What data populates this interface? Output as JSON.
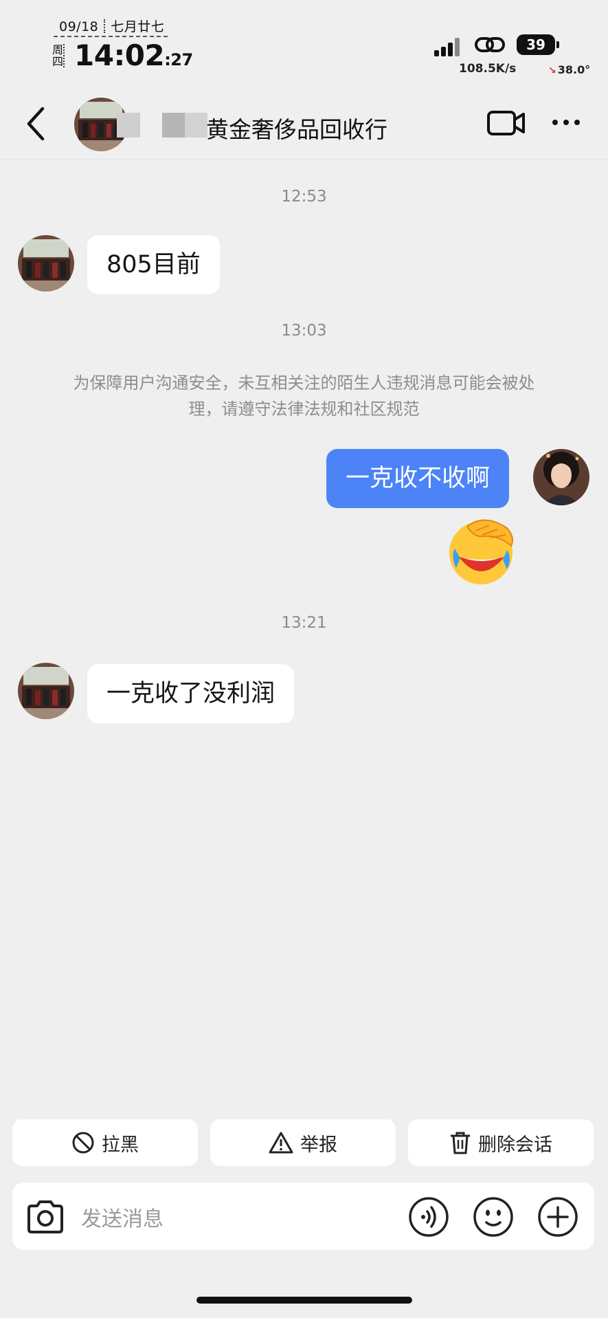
{
  "status_bar": {
    "date": "09/18",
    "lunar": "七月廿七",
    "weekday": "周四",
    "time": "14:02",
    "seconds": ":27",
    "battery": "39",
    "net_speed": "108.5K/s",
    "temperature": "38.0°"
  },
  "header": {
    "title": "黄金奢侈品回收行"
  },
  "messages": [
    {
      "type": "time",
      "text": "12:53"
    },
    {
      "type": "incoming",
      "text": "805目前"
    },
    {
      "type": "time",
      "text": "13:03"
    },
    {
      "type": "notice",
      "text": "为保障用户沟通安全，未互相关注的陌生人违规消息可能会被处理，请遵守法律法规和社区规范"
    },
    {
      "type": "outgoing",
      "text": "一克收不收啊"
    },
    {
      "type": "outgoing_emoji",
      "icon": "crying-laughing-facepalm-emoji"
    },
    {
      "type": "time",
      "text": "13:21"
    },
    {
      "type": "incoming",
      "text": "一克收了没利润"
    }
  ],
  "actions": [
    {
      "label": "拉黑",
      "icon": "block-icon"
    },
    {
      "label": "举报",
      "icon": "warning-icon"
    },
    {
      "label": "删除会话",
      "icon": "trash-icon"
    }
  ],
  "input": {
    "placeholder": "发送消息"
  },
  "colors": {
    "background": "#efefef",
    "outgoing_bubble": "#4c84f7",
    "incoming_bubble": "#ffffff"
  }
}
